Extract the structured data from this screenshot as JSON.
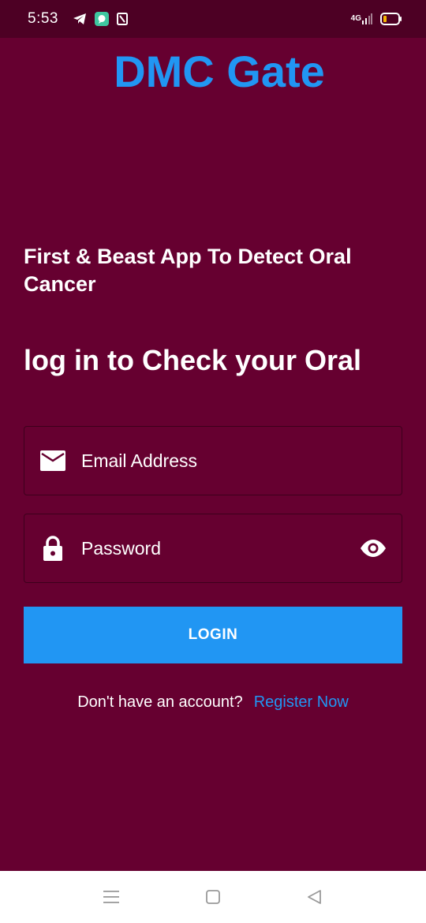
{
  "status_bar": {
    "time": "5:53",
    "network": "4G",
    "icons": [
      "telegram-icon",
      "message-app-icon",
      "notification-icon",
      "signal-icon",
      "battery-icon"
    ]
  },
  "app": {
    "title": "DMC Gate",
    "tagline": "First & Beast App To Detect Oral Cancer",
    "subtitle": "log in to Check your Oral"
  },
  "form": {
    "email_placeholder": "Email Address",
    "password_placeholder": "Password",
    "login_label": "LOGIN"
  },
  "register": {
    "prompt": "Don't have an account?",
    "link": "Register Now"
  },
  "nav_bar": {
    "icons": [
      "menu-icon",
      "home-icon",
      "back-icon"
    ]
  },
  "colors": {
    "background": "#660030",
    "status_bar": "#4d0024",
    "accent": "#2196f3",
    "text": "#ffffff"
  }
}
